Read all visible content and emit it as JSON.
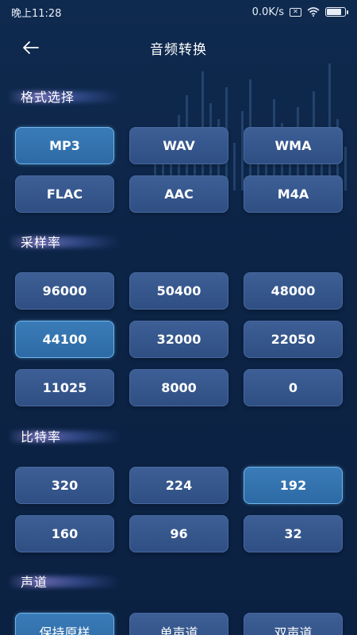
{
  "status_bar": {
    "time": "晚上11:28",
    "network_speed": "0.0K/s",
    "icons": [
      "sim-off-icon",
      "wifi-icon",
      "battery-icon"
    ],
    "battery_level_percent": 80
  },
  "header": {
    "back_icon": "arrow-left-icon",
    "title": "音频转换"
  },
  "sections": {
    "format": {
      "title": "格式选择",
      "options": [
        "MP3",
        "WAV",
        "WMA",
        "FLAC",
        "AAC",
        "M4A"
      ],
      "selected": "MP3"
    },
    "sample_rate": {
      "title": "采样率",
      "options": [
        "96000",
        "50400",
        "48000",
        "44100",
        "32000",
        "22050",
        "11025",
        "8000",
        "0"
      ],
      "selected": "44100"
    },
    "bit_rate": {
      "title": "比特率",
      "options": [
        "320",
        "224",
        "192",
        "160",
        "96",
        "32"
      ],
      "selected": "192"
    },
    "channel": {
      "title": "声道",
      "options": [
        "保持原样",
        "单声道",
        "双声道"
      ],
      "selected": "保持原样"
    }
  },
  "colors": {
    "background": "#0c2446",
    "button": "#36568b",
    "button_selected": "#3373ae",
    "selected_border": "#6fb6ec"
  }
}
